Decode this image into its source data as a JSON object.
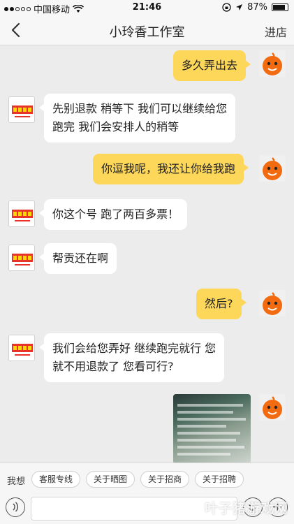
{
  "status_bar": {
    "carrier": "中国移动",
    "time": "21:46",
    "battery": "87%",
    "wifi_icon": "wifi-icon",
    "location_icon": "location-arrow-icon",
    "lock_icon": "rotation-lock-icon"
  },
  "nav": {
    "title": "小玲香工作室",
    "enter_shop": "进店",
    "back_icon": "chevron-left-icon"
  },
  "messages": [
    {
      "from": "me",
      "text": "多久弄出去"
    },
    {
      "from": "shop",
      "lines": [
        "先别退款 稍等下 我们可以继续给您",
        "跑完  我们会安排人的稍等"
      ]
    },
    {
      "from": "me",
      "text": "你逗我呢，我还让你给我跑"
    },
    {
      "from": "shop",
      "text": "你这个号 跑了两百多票！"
    },
    {
      "from": "shop",
      "text": "帮贡还在啊"
    },
    {
      "from": "me",
      "text": "然后?"
    },
    {
      "from": "shop",
      "lines": [
        "我们会给您弄好 继续跑完就行   您",
        "就不用退款了 您看可行?"
      ]
    },
    {
      "from": "me",
      "type": "image"
    }
  ],
  "quick_replies": {
    "label": "我想",
    "items": [
      "客服专线",
      "关于晒图",
      "关于招商",
      "关于招聘"
    ]
  },
  "watermark": "叶子猪游戏网",
  "colors": {
    "my_bubble": "#fdd75a",
    "shop_bubble": "#ffffff",
    "background": "#ececec"
  }
}
